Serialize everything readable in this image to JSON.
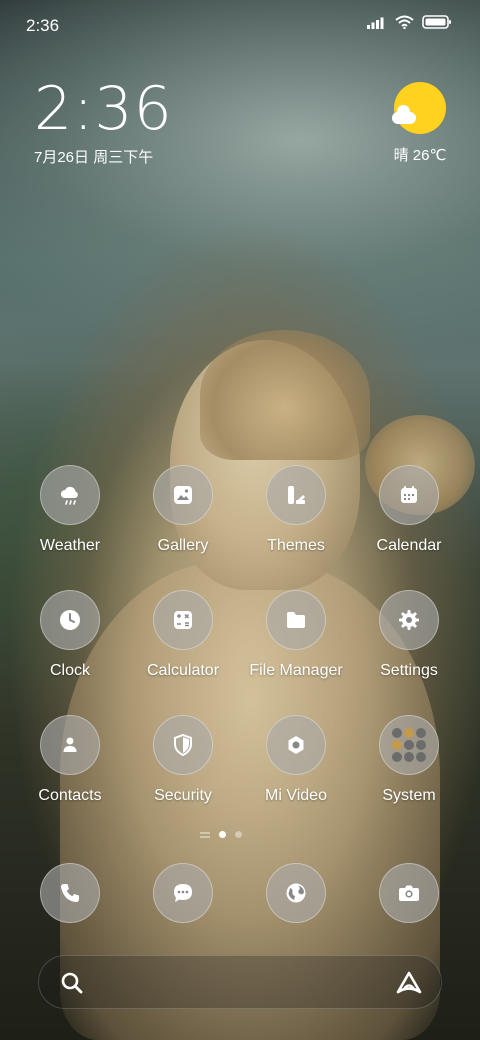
{
  "status_bar": {
    "time": "2:36",
    "icons": [
      "signal-icon",
      "wifi-icon",
      "battery-icon"
    ]
  },
  "clock_widget": {
    "time": "2:36",
    "date": "7月26日 周三下午"
  },
  "weather_widget": {
    "icon": "sun-cloud-icon",
    "text": "晴 26℃"
  },
  "apps": [
    {
      "label": "Weather",
      "icon": "weather-icon"
    },
    {
      "label": "Gallery",
      "icon": "gallery-icon"
    },
    {
      "label": "Themes",
      "icon": "themes-icon"
    },
    {
      "label": "Calendar",
      "icon": "calendar-icon"
    },
    {
      "label": "Clock",
      "icon": "clock-icon"
    },
    {
      "label": "Calculator",
      "icon": "calculator-icon"
    },
    {
      "label": "File Manager",
      "icon": "folder-icon"
    },
    {
      "label": "Settings",
      "icon": "gear-icon"
    },
    {
      "label": "Contacts",
      "icon": "contacts-icon"
    },
    {
      "label": "Security",
      "icon": "shield-icon"
    },
    {
      "label": "Mi Video",
      "icon": "video-icon"
    },
    {
      "label": "System",
      "icon": "folder-grid-icon"
    }
  ],
  "page_indicator": {
    "pages": 2,
    "active": 1
  },
  "dock": [
    {
      "icon": "phone-icon"
    },
    {
      "icon": "message-icon"
    },
    {
      "icon": "browser-icon"
    },
    {
      "icon": "camera-icon"
    }
  ],
  "search_bar": {
    "search_icon": "search-icon",
    "assistant_icon": "assistant-icon"
  },
  "colors": {
    "sun": "#ffd21f",
    "icon_bg": "rgba(170,170,170,0.62)",
    "text": "#ffffff"
  }
}
